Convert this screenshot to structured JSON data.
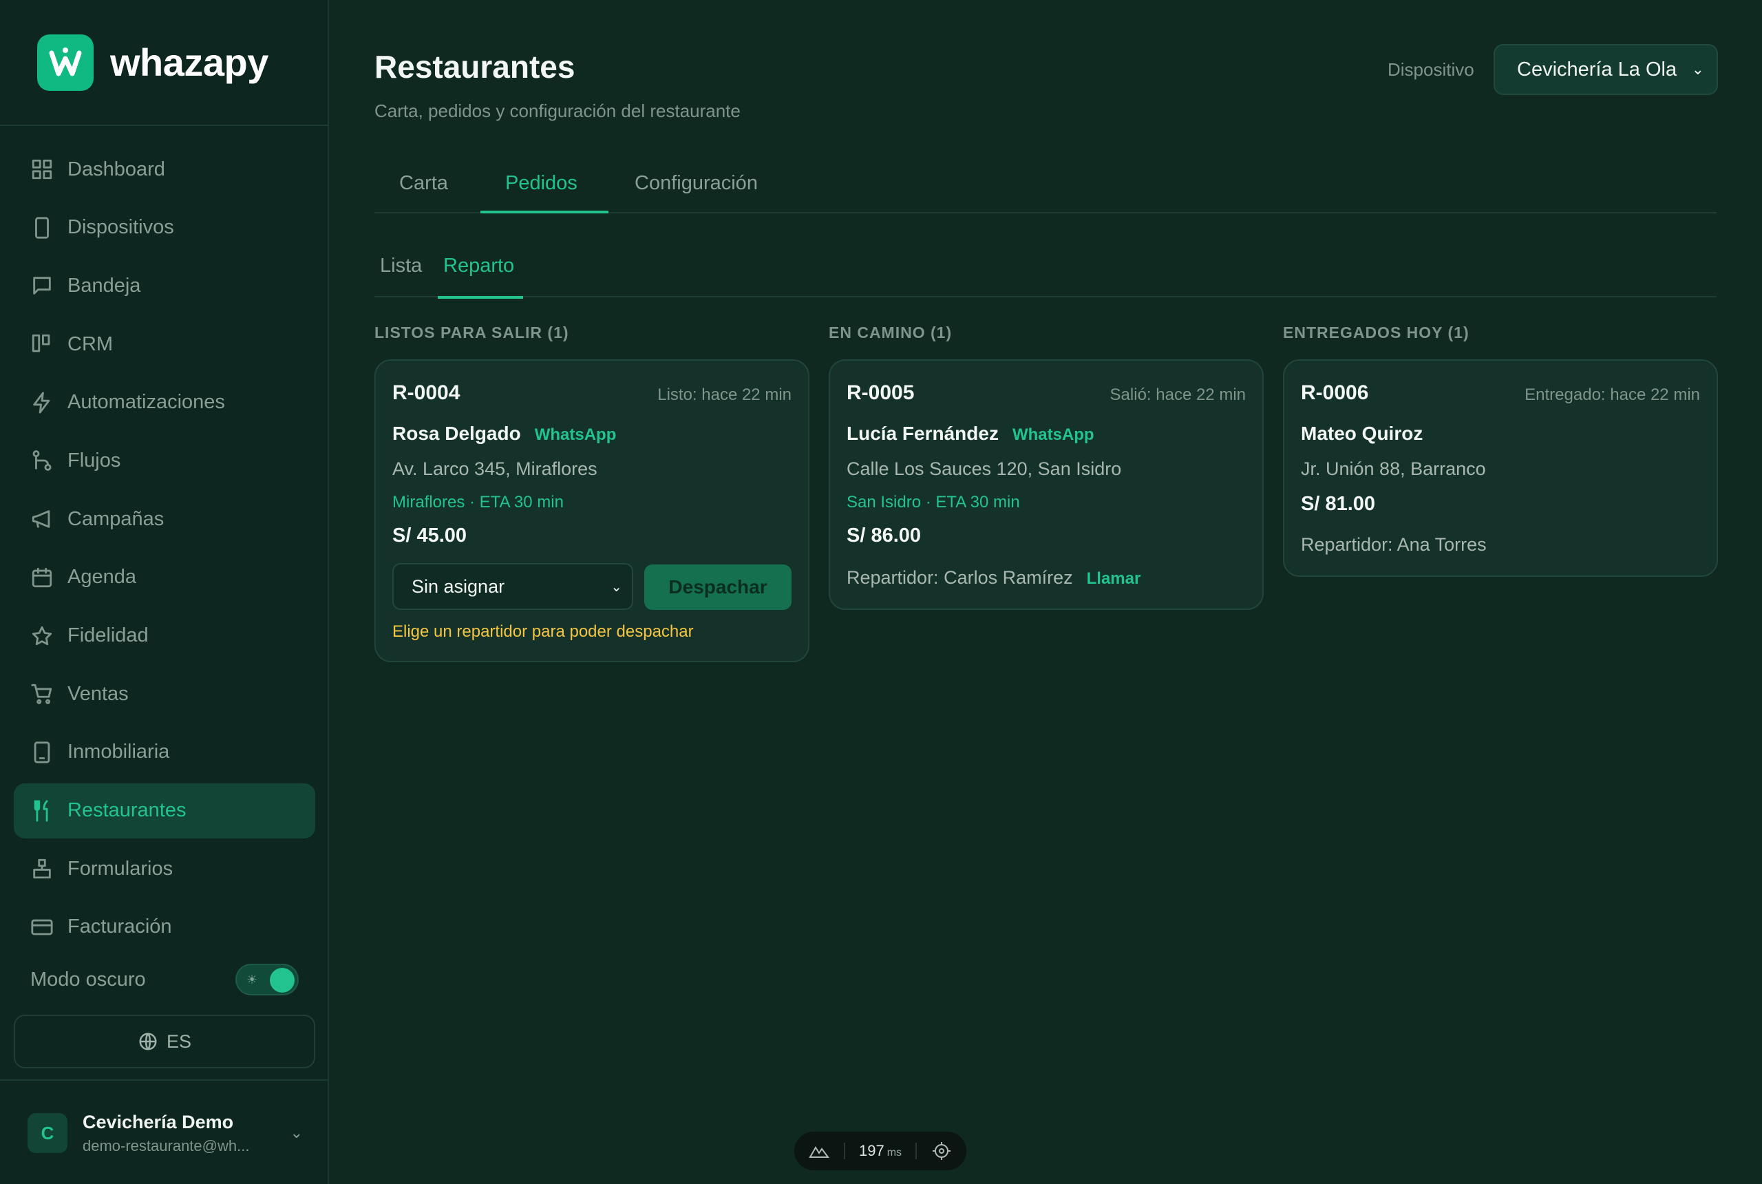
{
  "brand": {
    "name": "whazapy"
  },
  "sidebar": {
    "items": [
      {
        "label": "Dashboard",
        "icon": "grid-icon"
      },
      {
        "label": "Dispositivos",
        "icon": "phone-icon"
      },
      {
        "label": "Bandeja",
        "icon": "chat-icon"
      },
      {
        "label": "CRM",
        "icon": "kanban-icon"
      },
      {
        "label": "Automatizaciones",
        "icon": "lightning-icon"
      },
      {
        "label": "Flujos",
        "icon": "flow-icon"
      },
      {
        "label": "Campañas",
        "icon": "megaphone-icon"
      },
      {
        "label": "Agenda",
        "icon": "calendar-icon"
      },
      {
        "label": "Fidelidad",
        "icon": "star-icon"
      },
      {
        "label": "Ventas",
        "icon": "cart-icon"
      },
      {
        "label": "Inmobiliaria",
        "icon": "building-icon"
      },
      {
        "label": "Restaurantes",
        "icon": "utensils-icon",
        "active": true
      },
      {
        "label": "Formularios",
        "icon": "form-icon"
      },
      {
        "label": "Facturación",
        "icon": "credit-card-icon"
      }
    ],
    "dark_mode_label": "Modo oscuro",
    "dark_mode_on": true,
    "language": "ES",
    "user": {
      "initial": "C",
      "name": "Cevichería Demo",
      "email": "demo-restaurante@wh..."
    }
  },
  "header": {
    "title": "Restaurantes",
    "subtitle": "Carta, pedidos y configuración del restaurante",
    "device_label": "Dispositivo",
    "device_value": "Cevichería La Ola"
  },
  "tabs": {
    "carta": "Carta",
    "pedidos": "Pedidos",
    "config": "Configuración",
    "active": "Pedidos"
  },
  "subtabs": {
    "lista": "Lista",
    "reparto": "Reparto",
    "active": "Reparto"
  },
  "columns": {
    "ready": {
      "title": "LISTOS PARA SALIR (1)",
      "order": {
        "id": "R-0004",
        "time": "Listo: hace 22 min",
        "customer": "Rosa Delgado",
        "channel": "WhatsApp",
        "address": "Av. Larco 345, Miraflores",
        "zone": "Miraflores · ETA 30 min",
        "total": "S/ 45.00",
        "assign_value": "Sin asignar",
        "dispatch_label": "Despachar",
        "warning": "Elige un repartidor para poder despachar"
      }
    },
    "on_way": {
      "title": "EN CAMINO (1)",
      "order": {
        "id": "R-0005",
        "time": "Salió: hace 22 min",
        "customer": "Lucía Fernández",
        "channel": "WhatsApp",
        "address": "Calle Los Sauces 120, San Isidro",
        "zone": "San Isidro · ETA 30 min",
        "total": "S/ 86.00",
        "courier": "Repartidor: Carlos Ramírez",
        "call_label": "Llamar"
      }
    },
    "delivered": {
      "title": "ENTREGADOS HOY (1)",
      "order": {
        "id": "R-0006",
        "time": "Entregado: hace 22 min",
        "customer": "Mateo Quiroz",
        "address": "Jr. Unión 88, Barranco",
        "total": "S/ 81.00",
        "courier": "Repartidor: Ana Torres"
      }
    }
  },
  "devbar": {
    "value": "197",
    "unit": "ms"
  },
  "colors": {
    "accent": "#22c38e",
    "background": "#0f2921",
    "warning": "#f5c542"
  }
}
